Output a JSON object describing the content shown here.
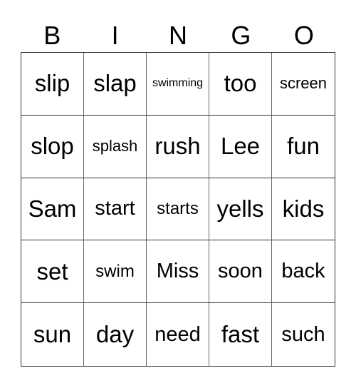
{
  "header": [
    "B",
    "I",
    "N",
    "G",
    "O"
  ],
  "cells": [
    "slip",
    "slap",
    "swimming",
    "too",
    "screen",
    "slop",
    "splash",
    "rush",
    "Lee",
    "fun",
    "Sam",
    "start",
    "starts",
    "yells",
    "kids",
    "set",
    "swim",
    "Miss",
    "soon",
    "back",
    "sun",
    "day",
    "need",
    "fast",
    "such"
  ]
}
